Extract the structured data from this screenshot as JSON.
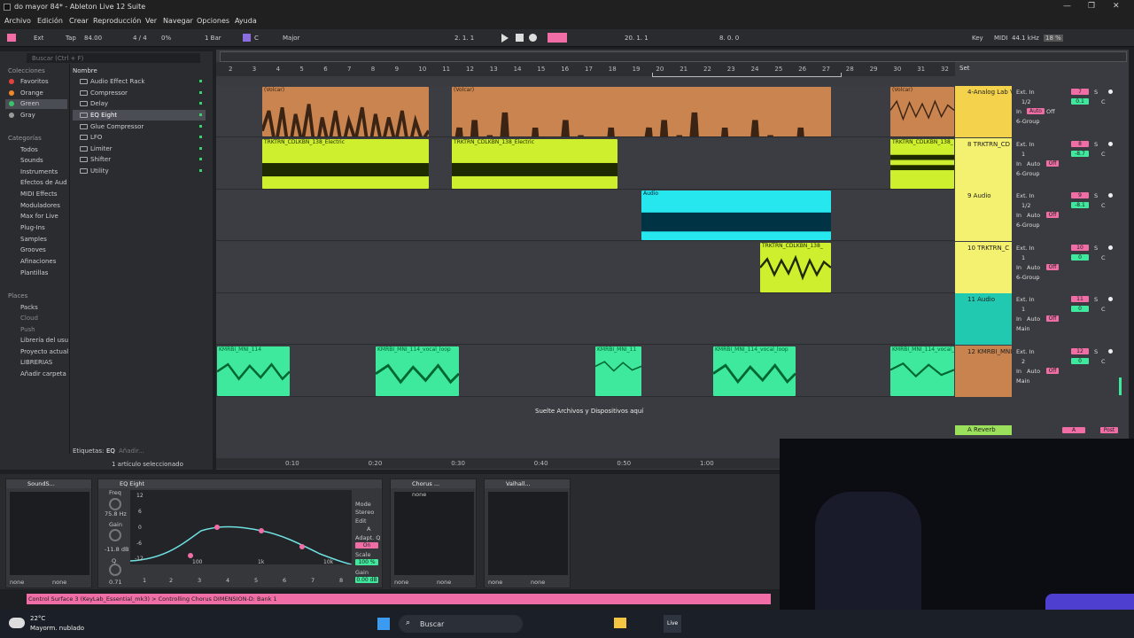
{
  "window": {
    "title": "do mayor  84* - Ableton Live 12 Suite"
  },
  "menu": [
    "Archivo",
    "Edición",
    "Crear",
    "Reproducción",
    "Ver",
    "Navegar",
    "Opciones",
    "Ayuda"
  ],
  "control": {
    "ext": "Ext",
    "tap": "Tap",
    "tempo": "84.00",
    "signature": "4 / 4",
    "percent": "0%",
    "quant": "1 Bar",
    "key": "C",
    "scale": "Major",
    "position": "2.   1.   1",
    "loop_start": "20.   1.   1",
    "loop_len": "8.   0.   0",
    "key_label": "Key",
    "midi_label": "MIDI",
    "sample_rate": "44.1 kHz",
    "cpu": "18 %"
  },
  "browser": {
    "search_placeholder": "Buscar (Ctrl + F)",
    "col_header": "Nombre",
    "collections_title": "Colecciones",
    "collections": [
      {
        "label": "Favoritos",
        "color": "#e0453d"
      },
      {
        "label": "Orange",
        "color": "#f08a28"
      },
      {
        "label": "Green",
        "color": "#39c46a"
      },
      {
        "label": "Gray",
        "color": "#9a9a9a"
      }
    ],
    "categories_title": "Categorías",
    "categories": [
      "Todos",
      "Sounds",
      "Instruments",
      "Efectos de Aud",
      "MIDI Effects",
      "Moduladores",
      "Max for Live",
      "Plug-Ins",
      "Samples",
      "Grooves",
      "Afinaciones",
      "Plantillas"
    ],
    "places_title": "Places",
    "places": [
      "Packs",
      "Cloud",
      "Push",
      "Librería del usu",
      "Proyecto actual",
      "LIBRERIAS",
      "Añadir carpeta"
    ],
    "items": [
      "Audio Effect Rack",
      "Compressor",
      "Delay",
      "EQ Eight",
      "Glue Compressor",
      "LFO",
      "Limiter",
      "Shifter",
      "Utility"
    ],
    "selected_item": "EQ Eight",
    "tags_label": "Etiquetas:",
    "tags_value": "EQ",
    "tags_add": "Añadir...",
    "selection_count": "1 artículo seleccionado"
  },
  "ruler": [
    "2",
    "3",
    "4",
    "5",
    "6",
    "7",
    "8",
    "9",
    "10",
    "11",
    "12",
    "13",
    "14",
    "15",
    "16",
    "17",
    "18",
    "19",
    "20",
    "21",
    "22",
    "23",
    "24",
    "25",
    "26",
    "27",
    "28",
    "29",
    "30",
    "31",
    "32"
  ],
  "set_label": "Set",
  "time_ticks": [
    "0:10",
    "0:20",
    "0:30",
    "0:40",
    "0:50",
    "1:00"
  ],
  "tracks": [
    {
      "name": "4-Analog Lab V",
      "color": "#f4d24c",
      "input": "Ext. In",
      "ch": "1/2",
      "mon": "Auto",
      "out": "6-Group",
      "num": "7",
      "vol": "0.1",
      "pan": "C"
    },
    {
      "name": "8 TRKTRN_CD",
      "color": "#f4f070",
      "input": "Ext. In",
      "ch": "1",
      "mon": "Off",
      "out": "6-Group",
      "num": "8",
      "vol": "-8.7",
      "pan": "C"
    },
    {
      "name": "9 Audio",
      "color": "#f4f070",
      "input": "Ext. In",
      "ch": "1/2",
      "mon": "Off",
      "out": "6-Group",
      "num": "9",
      "vol": "-8.1",
      "pan": "C"
    },
    {
      "name": "10 TRKTRN_C",
      "color": "#f4f070",
      "input": "Ext. In",
      "ch": "1",
      "mon": "Off",
      "out": "6-Group",
      "num": "10",
      "vol": "0",
      "pan": "C"
    },
    {
      "name": "11 Audio",
      "color": "#22c9b1",
      "input": "Ext. In",
      "ch": "1",
      "mon": "Off",
      "out": "Main",
      "num": "11",
      "vol": "0",
      "pan": "C"
    },
    {
      "name": "12 KMRBI_MNI",
      "color": "#c8834e",
      "input": "Ext. In",
      "ch": "2",
      "mon": "Off",
      "out": "Main",
      "num": "12",
      "vol": "0",
      "pan": "C"
    }
  ],
  "clip_labels": {
    "volcar": "(Volcar)",
    "trk": "TRKTRN_CDLKBN_138_Electric",
    "trk_short": "TRKTRN_CDLKBN_138_",
    "audio": "Audio",
    "kmr": "KMRBI_MNI_114_vocal_loop",
    "kmr_short": "KMRBI_MNI_114",
    "kmr_tiny": "KMRBI_MNI_11"
  },
  "drop_text": "Suelte Archivos y Dispositivos aquí",
  "return_track": {
    "name": "A Reverb",
    "label_a": "A",
    "post": "Post"
  },
  "mix_labels": {
    "in": "In",
    "auto": "Auto",
    "off": "Off",
    "s": "S",
    "inf": "-∞"
  },
  "devices": {
    "sound": "SoundS...",
    "eq": "EQ Eight",
    "chorus": "Chorus ...",
    "valhalla": "Valhall...",
    "freq_label": "Freq",
    "freq_val": "75.8 Hz",
    "gain_label": "Gain",
    "gain_val": "-11.8 dB",
    "q_label": "Q",
    "q_val": "0.71",
    "mode_label": "Mode",
    "mode_val": "Stereo",
    "edit_label": "Edit",
    "edit_val": "A",
    "adapt_label": "Adapt. Q",
    "adapt_val": "On",
    "scale_label": "Scale",
    "scale_val": "100 %",
    "gain2_label": "Gain",
    "gain2_val": "0.00 dB",
    "db_ticks": [
      "12",
      "6",
      "0",
      "-6",
      "-12"
    ],
    "hz_ticks": [
      "100",
      "1k",
      "10k"
    ],
    "none": "none",
    "bands": [
      "1",
      "2",
      "3",
      "4",
      "5",
      "6",
      "7",
      "8"
    ]
  },
  "status": "Control Surface 3 (KeyLab_Essential_mk3) > Controlling Chorus DIMENSION-D: Bank 1",
  "taskbar": {
    "temp": "22°C",
    "weather": "Mayorm. nublado",
    "search": "Buscar",
    "live": "Live"
  }
}
